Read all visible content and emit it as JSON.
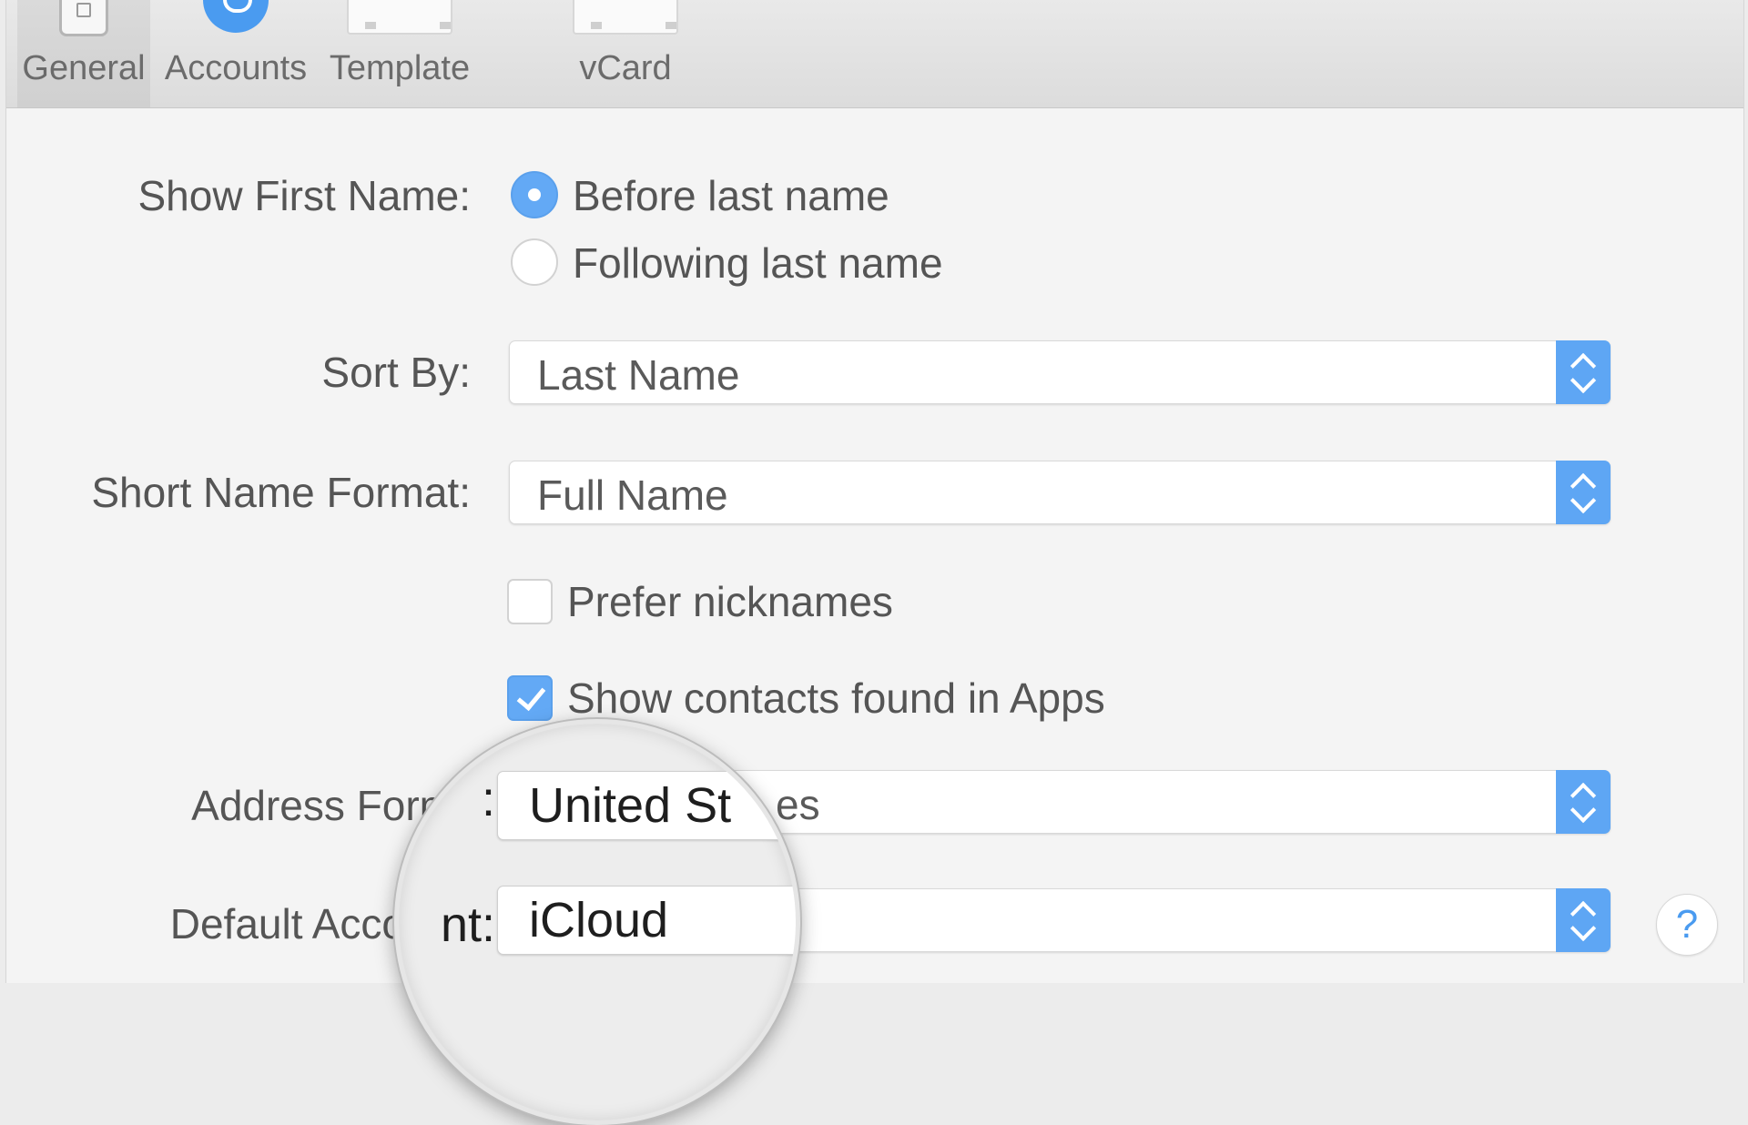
{
  "toolbar": {
    "tabs": [
      {
        "label": "General",
        "icon": "general-icon",
        "active": true
      },
      {
        "label": "Accounts",
        "icon": "accounts-icon"
      },
      {
        "label": "Template",
        "icon": "template-icon"
      },
      {
        "label": "vCard",
        "icon": "vcard-icon"
      }
    ]
  },
  "form": {
    "show_first_name": {
      "label": "Show First Name:",
      "options": [
        "Before last name",
        "Following last name"
      ],
      "selected": "Before last name"
    },
    "sort_by": {
      "label": "Sort By:",
      "value": "Last Name"
    },
    "short_name_format": {
      "label": "Short Name Format:",
      "value": "Full Name"
    },
    "prefer_nicknames": {
      "label": "Prefer nicknames",
      "checked": false
    },
    "show_contacts_in_apps": {
      "label": "Show contacts found in Apps",
      "checked": true
    },
    "address_format": {
      "label": "Address Form",
      "value": "es"
    },
    "default_account": {
      "label": "Default Acco",
      "value": ""
    }
  },
  "magnifier": {
    "address_value": "United St",
    "default_label": "nt:",
    "address_label_tail": ":",
    "default_value": "iCloud"
  },
  "help": {
    "glyph": "?"
  },
  "colors": {
    "accent": "#5ea6f4",
    "window_bg": "#f4f4f4",
    "toolbar_bg": "#e0e0e0"
  }
}
